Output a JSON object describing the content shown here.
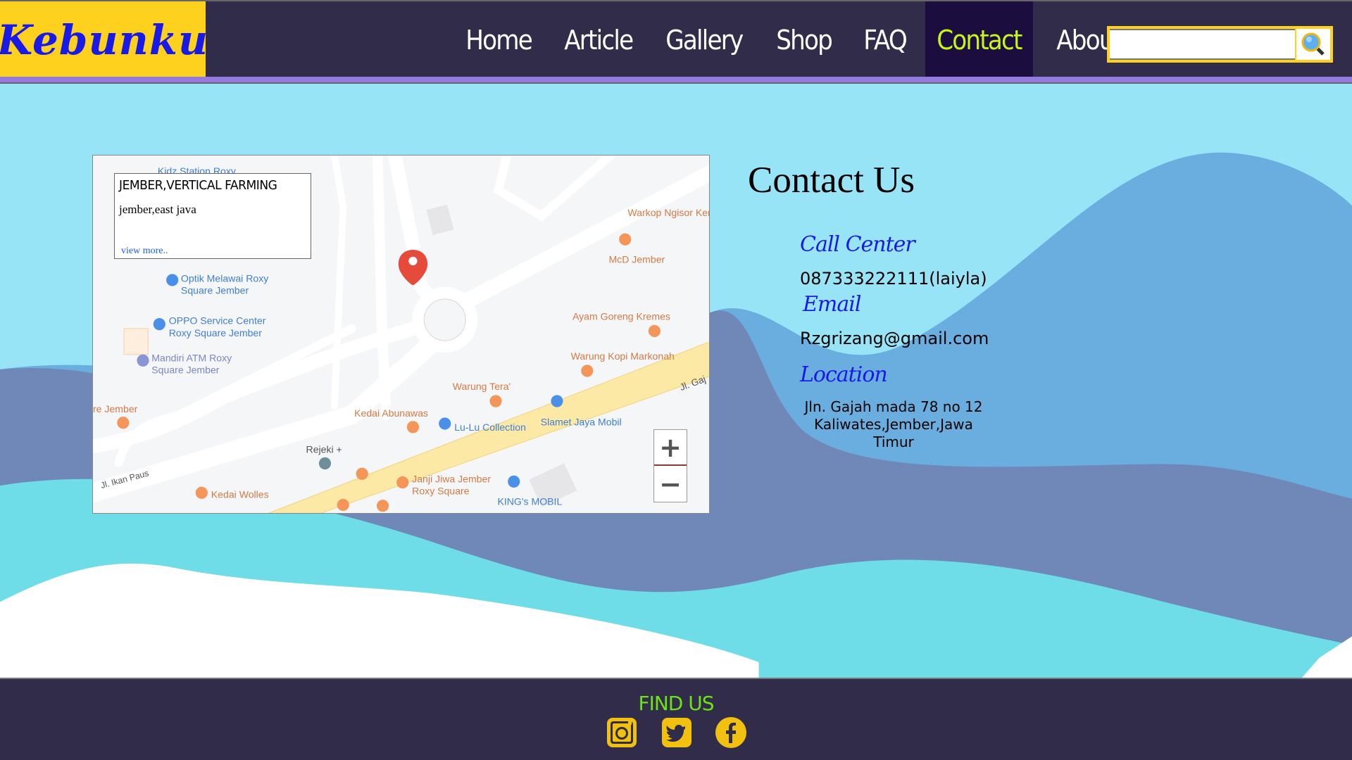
{
  "header": {
    "logo": "Kebunku",
    "nav": [
      "Home",
      "Article",
      "Gallery",
      "Shop",
      "FAQ",
      "Contact",
      "About"
    ],
    "active": "Contact",
    "search": {
      "value": "",
      "placeholder": ""
    }
  },
  "map": {
    "popup": {
      "title": "JEMBER,VERTICAL FARMING",
      "subtitle": "jember,east java",
      "link": "view more.."
    },
    "labels": {
      "kidz": "Kidz Station Roxy",
      "warkop": "Warkop Ngisor Ker",
      "mcd": "McD Jember",
      "optik1": "Optik Melawai Roxy",
      "optik2": "Square Jember",
      "oppo1": "OPPO Service Center",
      "oppo2": "Roxy Square Jember",
      "mandiri1": "Mandiri ATM Roxy",
      "mandiri2": "Square Jember",
      "ayam": "Ayam Goreng Kremes",
      "markonah": "Warung Kopi Markonah",
      "tera": "Warung Tera'",
      "rejember": "re Jember",
      "abunawas": "Kedai Abunawas",
      "lulu": "Lu-Lu Collection",
      "slamet": "Slamet Jaya Mobil",
      "rejeki": "Rejeki +",
      "ikanpaus": "Jl. Ikan Paus",
      "janji1": "Janji Jiwa Jember",
      "janji2": "Roxy Square",
      "kings": "KING's MOBIL",
      "wolles": "Kedai Wolles",
      "gajah": "Jl. Gaj"
    },
    "zoom_in": "+",
    "zoom_out": "−"
  },
  "contact": {
    "title": "Contact Us",
    "call_label": "Call Center",
    "call": "087333222111(laiyla)",
    "email_label": "Email",
    "email": "Rzgrizang@gmail.com",
    "location_label": "Location",
    "address1": "Jln. Gajah mada 78 no 12",
    "address2": "Kaliwates,Jember,Jawa Timur"
  },
  "footer": {
    "title": "FIND US",
    "icons": [
      "instagram-icon",
      "twitter-icon",
      "facebook-icon"
    ]
  },
  "colors": {
    "header": "#302c4a",
    "logo_bg": "#fed11e",
    "active": "#c7f51a",
    "accent": "#9579e0",
    "icon": "#f2c00f",
    "findus": "#6ce414"
  }
}
